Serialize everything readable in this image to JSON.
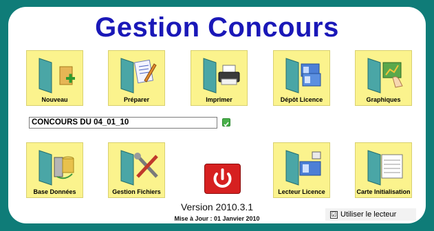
{
  "app": {
    "title": "Gestion Concours",
    "version": "Version 2010.3.1",
    "update": "Mise à Jour : 01 Janvier 2010"
  },
  "tiles_row1": [
    {
      "label": "Nouveau",
      "icon": "new-folder-icon"
    },
    {
      "label": "Préparer",
      "icon": "prepare-icon"
    },
    {
      "label": "Imprimer",
      "icon": "printer-icon"
    },
    {
      "label": "Dépôt Licence",
      "icon": "license-deposit-icon"
    },
    {
      "label": "Graphiques",
      "icon": "charts-icon"
    }
  ],
  "tiles_row2": [
    {
      "label": "Base Données",
      "icon": "database-icon"
    },
    {
      "label": "Gestion Fichiers",
      "icon": "tools-icon"
    },
    {
      "label": "Lecteur Licence",
      "icon": "license-reader-icon"
    },
    {
      "label": "Carte Initialisation",
      "icon": "init-card-icon"
    }
  ],
  "concours": {
    "value": "CONCOURS DU 04_01_10",
    "checked": true
  },
  "reader_checkbox": {
    "label": "Utiliser le lecteur",
    "checked": true,
    "mark": "☑"
  },
  "colors": {
    "background": "#0f7c78",
    "title": "#1a18b8",
    "tile": "#fbf38d",
    "power": "#d62020"
  }
}
